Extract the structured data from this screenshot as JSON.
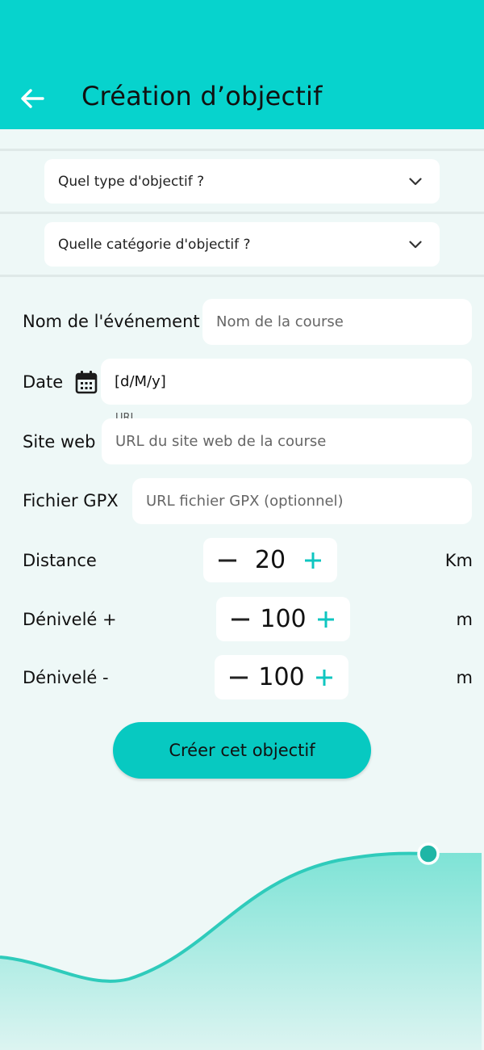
{
  "header": {
    "title": "Création d’objectif",
    "back_icon": "arrow-left-icon",
    "color": "#07d3cd"
  },
  "form": {
    "type_dropdown": {
      "label": "Quel type d'objectif ?"
    },
    "category_dropdown": {
      "label": "Quelle catégorie d'objectif ?"
    },
    "event_name": {
      "label": "Nom de l'événement",
      "placeholder": "Nom de la course",
      "value": ""
    },
    "date": {
      "label": "Date",
      "value": "[d/M/y]",
      "icon": "calendar-icon"
    },
    "website": {
      "label": "Site web",
      "floating_label": "URL",
      "placeholder": "URL du site web de la course",
      "value": ""
    },
    "gpx": {
      "label": "Fichier GPX",
      "placeholder": "URL fichier GPX (optionnel)",
      "value": ""
    },
    "distance": {
      "label": "Distance",
      "value": "20",
      "unit": "Km"
    },
    "elev_gain": {
      "label": "Dénivelé +",
      "value": "100",
      "unit": "m"
    },
    "elev_loss": {
      "label": "Dénivelé -",
      "value": "100",
      "unit": "m"
    },
    "submit_label": "Créer cet objectif"
  },
  "colors": {
    "accent": "#07d3cd",
    "button": "#07c9c1",
    "plus": "#0fc6c0",
    "background": "#eef8f7"
  }
}
